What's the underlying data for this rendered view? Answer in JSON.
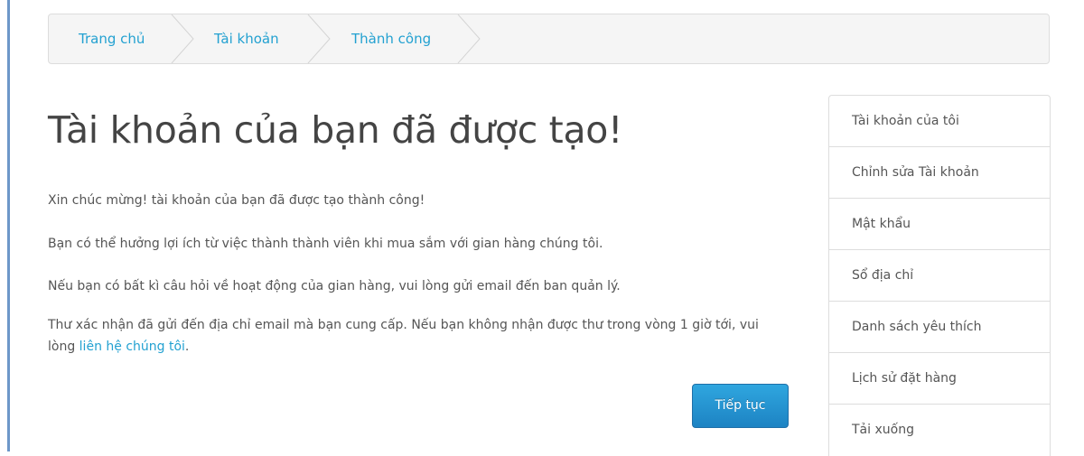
{
  "breadcrumb": {
    "items": [
      {
        "label": "Trang chủ"
      },
      {
        "label": "Tài khoản"
      },
      {
        "label": "Thành công"
      }
    ]
  },
  "main": {
    "title": "Tài khoản của bạn đã được tạo!",
    "paragraphs": [
      "Xin chúc mừng! tài khoản của bạn đã được tạo thành công!",
      "Bạn có thể hưởng lợi ích từ việc thành thành viên khi mua sắm với gian hàng chúng tôi.",
      "Nếu bạn có bất kì câu hỏi về hoạt động của gian hàng, vui lòng gửi email đến ban quản lý."
    ],
    "confirmation": {
      "text": "Thư xác nhận đã gửi đến địa chỉ email mà bạn cung cấp. Nếu bạn không nhận được thư trong vòng 1 giờ tới, vui lòng ",
      "link_label": "liên hệ chúng tôi",
      "suffix": "."
    },
    "continue_label": "Tiếp tục"
  },
  "sidebar": {
    "items": [
      {
        "label": "Tài khoản của tôi"
      },
      {
        "label": "Chỉnh sửa Tài khoản"
      },
      {
        "label": "Mật khẩu"
      },
      {
        "label": "Sổ địa chỉ"
      },
      {
        "label": "Danh sách yêu thích"
      },
      {
        "label": "Lịch sử đặt hàng"
      },
      {
        "label": "Tải xuống"
      }
    ]
  },
  "colors": {
    "link": "#23a1d1",
    "button": "#1d83c3",
    "accent_bar": "#6d97c9"
  }
}
